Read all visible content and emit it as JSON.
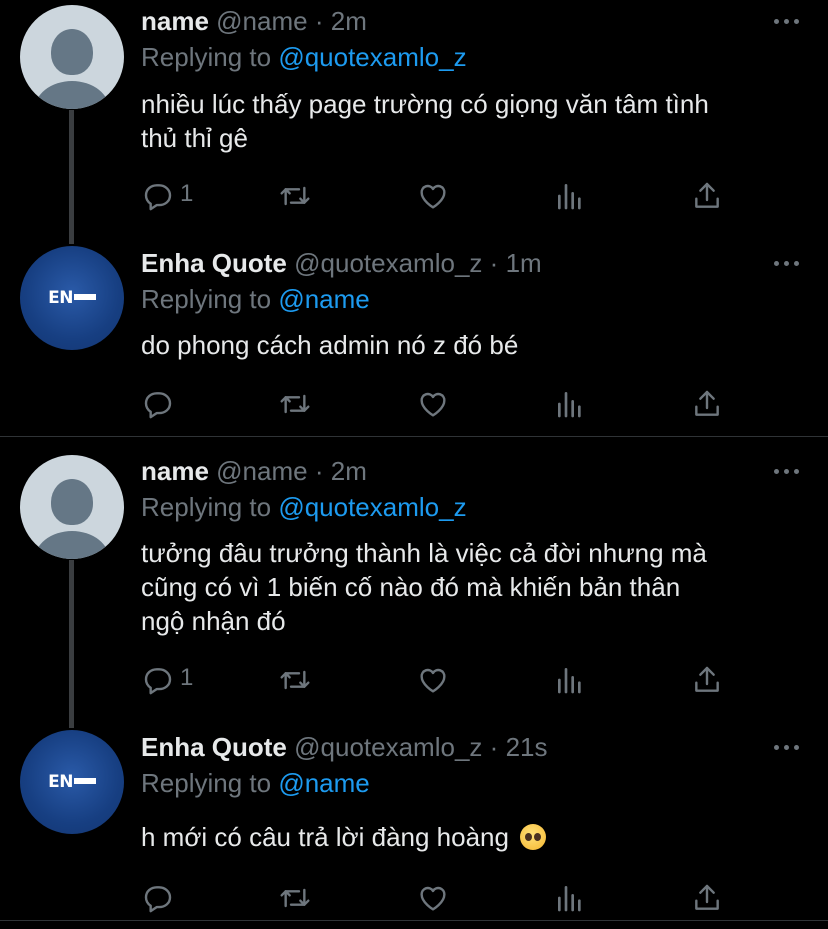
{
  "tweets": [
    {
      "name": "name",
      "handle": "@name",
      "dot": "·",
      "time": "2m",
      "replying_prefix": "Replying to",
      "replying_to": "@quotexamlo_z",
      "lines": [
        "nhiều lúc thấy page trường có giọng văn tâm tình",
        "thủ thỉ gê"
      ],
      "reply_count": "1",
      "avatar": "default-profile-avatar"
    },
    {
      "name": "Enha Quote",
      "handle": "@quotexamlo_z",
      "dot": "·",
      "time": "1m",
      "replying_prefix": "Replying to",
      "replying_to": "@name",
      "lines": [
        "do phong cách admin nó z đó bé"
      ],
      "reply_count": "",
      "avatar": "enha-logo-avatar",
      "avatar_text": "EN"
    },
    {
      "name": "name",
      "handle": "@name",
      "dot": "·",
      "time": "2m",
      "replying_prefix": "Replying to",
      "replying_to": "@quotexamlo_z",
      "lines": [
        "tưởng đâu trưởng thành là việc cả đời nhưng mà",
        "cũng có vì 1 biến cố nào đó mà khiến bản thân",
        "ngộ nhận đó"
      ],
      "reply_count": "1",
      "avatar": "default-profile-avatar"
    },
    {
      "name": "Enha Quote",
      "handle": "@quotexamlo_z",
      "dot": "·",
      "time": "21s",
      "replying_prefix": "Replying to",
      "replying_to": "@name",
      "lines": [
        "h mới có câu trả lời đàng hoàng"
      ],
      "emoji": "pleading-face-emoji",
      "reply_count": "",
      "avatar": "enha-logo-avatar",
      "avatar_text": "EN"
    }
  ],
  "icons": {
    "reply": "reply-icon",
    "retweet": "retweet-icon",
    "like": "heart-icon",
    "views": "analytics-icon",
    "share": "share-icon",
    "more": "more-icon"
  },
  "colors": {
    "background": "#000000",
    "text": "#e7e9ea",
    "muted": "#6e767d",
    "accent": "#1d9bf0",
    "divider": "#2f3336",
    "thread_line": "#3a3d40"
  }
}
